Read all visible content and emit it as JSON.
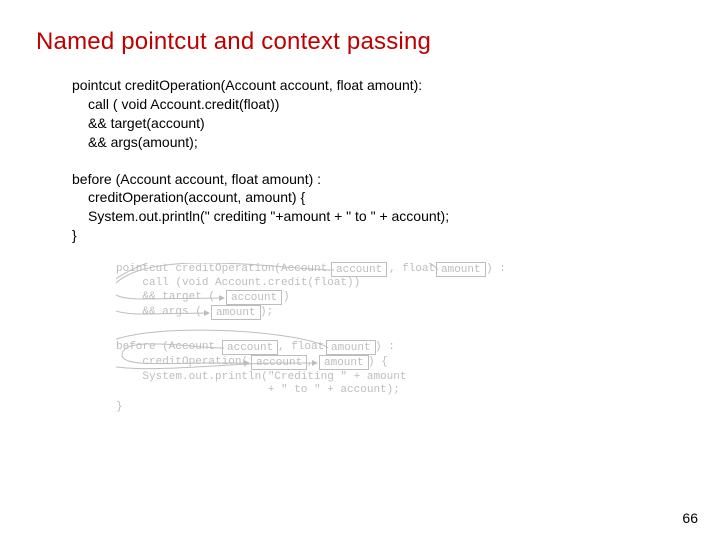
{
  "title": "Named pointcut and context passing",
  "pointcut_block": {
    "l1": "pointcut creditOperation(Account account, float amount):",
    "l2": "call ( void Account.credit(float))",
    "l3": "&& target(account)",
    "l4": "&& args(amount);"
  },
  "advice_block": {
    "l1": "before (Account account, float amount) :",
    "l2": "creditOperation(account, amount) {",
    "l3": "System.out.println(\" crediting \"+amount + \" to \" + account);",
    "l4": "}"
  },
  "diagram": {
    "t_pointcut": "pointcut creditOperation(Account",
    "t_pointcut2": ", float",
    "t_pointcut3": ") :",
    "t_call": "    call (void Account.credit(float))",
    "t_target": "    && target (",
    "t_target2": ")",
    "t_args": "    && args (",
    "t_args2": ");",
    "box_account": "account",
    "box_amount": "amount",
    "t_before": "before (Account",
    "t_before2": ", float",
    "t_before3": ") :",
    "box_account2": "account",
    "box_amount2": "amount",
    "t_credop": "    creditOperation(",
    "t_credop2": ",",
    "t_credop3": ") {",
    "box_account3": "account",
    "box_amount3": "amount",
    "t_print": "    System.out.println(\"Crediting \" + amount",
    "t_print2": "                       + \" to \" + account);",
    "t_brace": "}"
  },
  "page_number": "66"
}
